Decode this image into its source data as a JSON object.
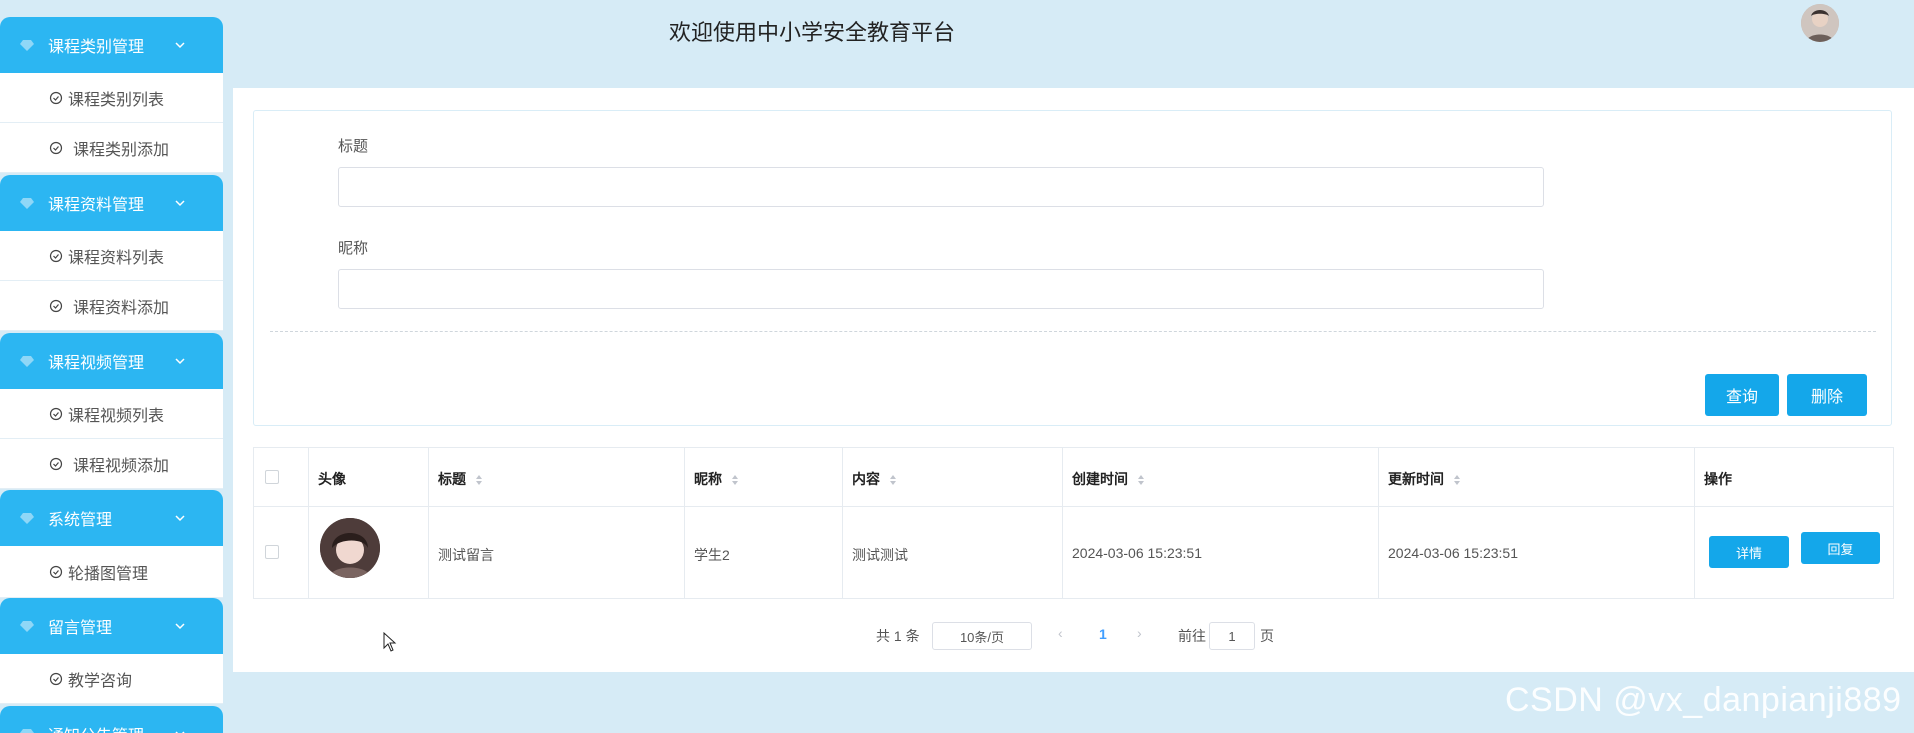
{
  "header": {
    "title": "欢迎使用中小学安全教育平台"
  },
  "sidebar": {
    "groups": [
      {
        "label": "课程类别管理",
        "items": [
          "课程类别列表",
          "课程类别添加"
        ]
      },
      {
        "label": "课程资料管理",
        "items": [
          "课程资料列表",
          "课程资料添加"
        ]
      },
      {
        "label": "课程视频管理",
        "items": [
          "课程视频列表",
          "课程视频添加"
        ]
      },
      {
        "label": "系统管理",
        "items": [
          "轮播图管理"
        ]
      },
      {
        "label": "留言管理",
        "items": [
          "教学咨询"
        ]
      },
      {
        "label": "通知公告管理",
        "items": []
      }
    ]
  },
  "search": {
    "title_label": "标题",
    "title_value": "",
    "nickname_label": "昵称",
    "nickname_value": "",
    "query_button": "查询",
    "delete_button": "删除"
  },
  "table": {
    "headers": [
      "头像",
      "标题",
      "昵称",
      "内容",
      "创建时间",
      "更新时间",
      "操作"
    ],
    "rows": [
      {
        "title": "测试留言",
        "nickname": "学生2",
        "content": "测试测试",
        "created": "2024-03-06 15:23:51",
        "updated": "2024-03-06 15:23:51",
        "detail_button": "详情",
        "reply_button": "回复"
      }
    ]
  },
  "pagination": {
    "total_text": "共 1 条",
    "page_size": "10条/页",
    "current_page": "1",
    "goto_label": "前往",
    "goto_value": "1",
    "page_suffix": "页"
  },
  "watermark": "CSDN @vx_danpianji889",
  "colors": {
    "accent": "#14a7ea",
    "sidebar_head": "#2cb6f2",
    "background": "#d6ebf6"
  }
}
